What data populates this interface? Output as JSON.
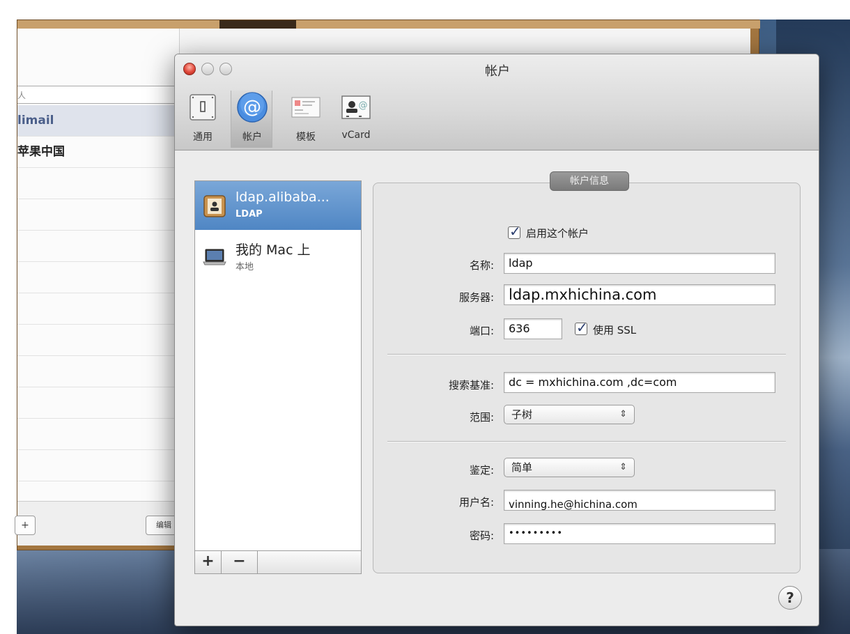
{
  "back_window": {
    "search_text": "人",
    "rows": [
      "limail",
      "苹果中国"
    ],
    "bottom_left_button": "+",
    "bottom_right_button": "编辑"
  },
  "window": {
    "title": "帐户",
    "toolbar": [
      {
        "label": "通用",
        "icon": "general-switch-icon"
      },
      {
        "label": "帐户",
        "icon": "at-sign-icon"
      },
      {
        "label": "模板",
        "icon": "template-card-icon"
      },
      {
        "label": "vCard",
        "icon": "vcard-icon"
      }
    ]
  },
  "accounts": [
    {
      "name": "ldap.alibaba...",
      "type": "LDAP",
      "selected": true,
      "icon": "address-book-icon"
    },
    {
      "name": "我的 Mac 上",
      "type": "本地",
      "selected": false,
      "icon": "laptop-icon"
    }
  ],
  "list_buttons": {
    "add": "+",
    "remove": "−"
  },
  "account_info": {
    "section_title": "帐户信息",
    "enable_label": "启用这个帐户",
    "name_label": "名称:",
    "name_value": "ldap",
    "server_label": "服务器:",
    "server_value": "ldap.mxhichina.com",
    "port_label": "端口:",
    "port_value": "636",
    "ssl_label": "使用 SSL",
    "search_base_label": "搜索基准:",
    "search_base_value": "dc = mxhichina.com   ,dc=com",
    "scope_label": "范围:",
    "scope_value": "子树",
    "auth_label": "鉴定:",
    "auth_value": "简单",
    "username_label": "用户名:",
    "username_value": "vinning.he@hichina.com",
    "password_label": "密码:",
    "password_value": "•••••••••"
  },
  "help_label": "?"
}
